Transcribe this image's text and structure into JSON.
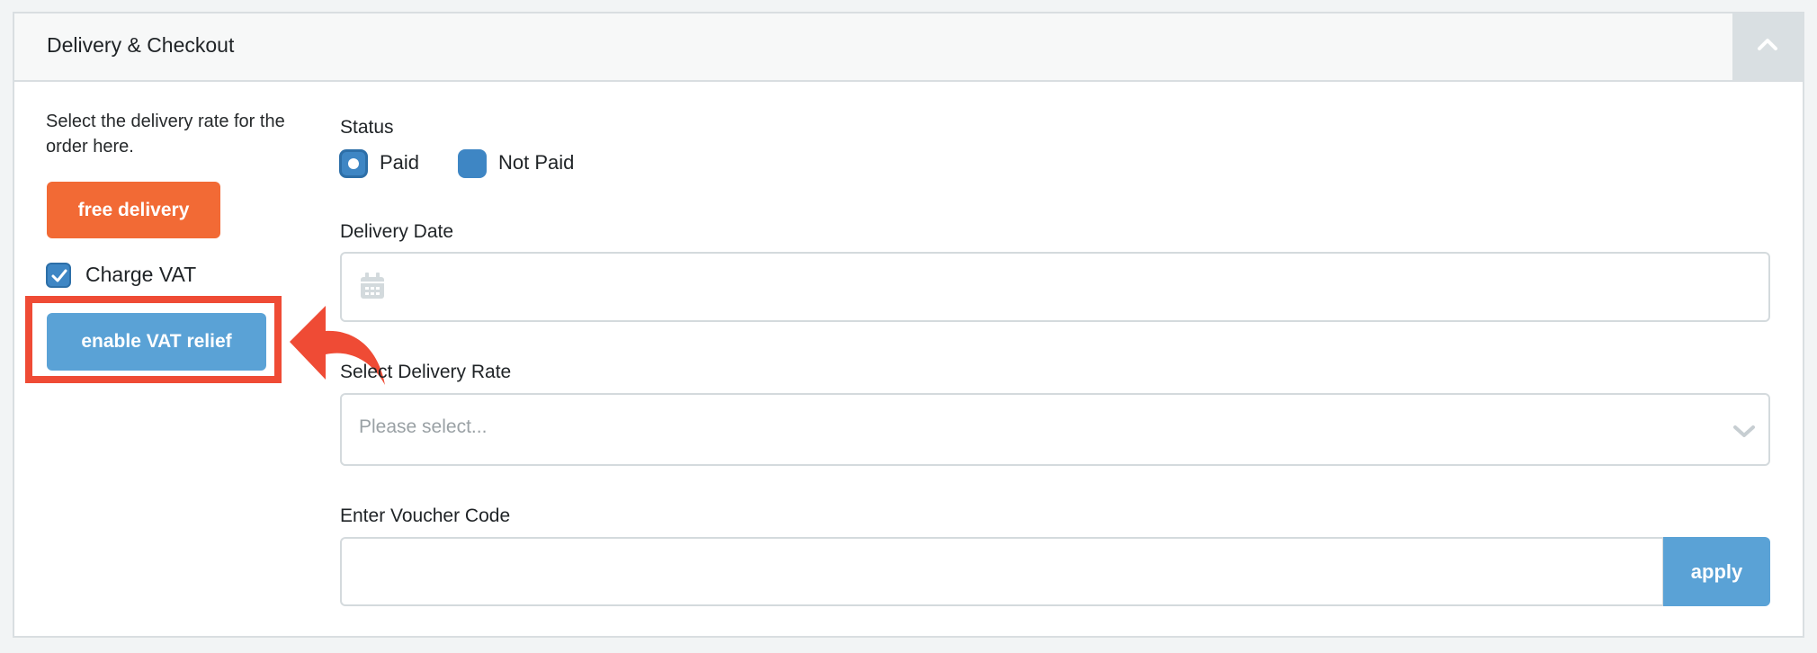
{
  "panel": {
    "title": "Delivery & Checkout",
    "collapse_icon": "chevron-up-icon"
  },
  "left": {
    "intro_text": "Select the delivery rate for the order here.",
    "free_delivery_label": "free delivery",
    "charge_vat": {
      "label": "Charge VAT",
      "checked": true
    },
    "vat_relief_label": "enable VAT relief"
  },
  "status": {
    "label": "Status",
    "options": [
      {
        "label": "Paid",
        "selected": true
      },
      {
        "label": "Not Paid",
        "selected": false
      }
    ]
  },
  "delivery_date": {
    "label": "Delivery Date",
    "value": "",
    "icon": "calendar-icon"
  },
  "delivery_rate": {
    "label": "Select Delivery Rate",
    "placeholder": "Please select...",
    "icon": "chevron-down-icon"
  },
  "voucher": {
    "label": "Enter Voucher Code",
    "value": "",
    "apply_label": "apply"
  },
  "colors": {
    "accent_orange": "#f26a35",
    "accent_blue": "#5aa2d6",
    "radio_blue": "#3e86c4",
    "highlight_red": "#ef4b35"
  }
}
